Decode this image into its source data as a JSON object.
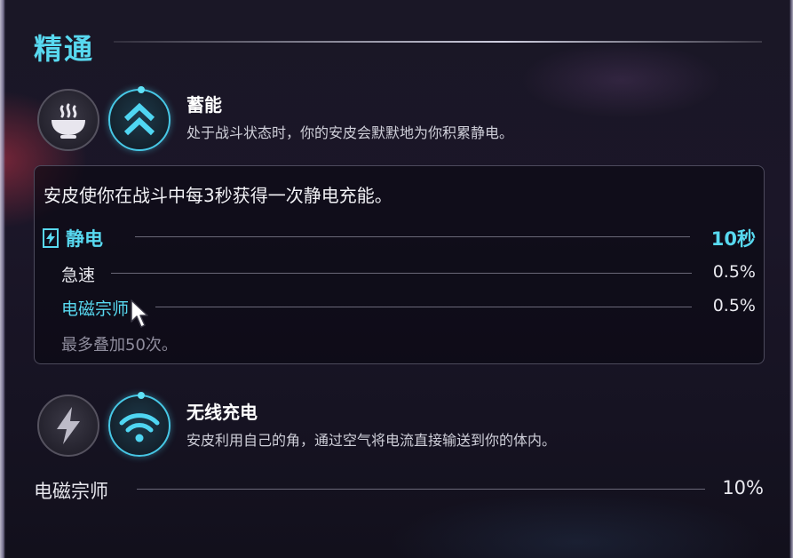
{
  "section": {
    "title": "精通"
  },
  "talent1": {
    "icon_left": "bowl-icon",
    "icon_right": "double-chevron-up-icon",
    "name": "蓄能",
    "description": "处于战斗状态时，你的安皮会默默地为你积累静电。"
  },
  "detail": {
    "main_text": "安皮使你在战斗中每3秒获得一次静电充能。",
    "rows": [
      {
        "label": "静电",
        "value": "10秒",
        "icon": "lightning-box-icon"
      },
      {
        "label": "急速",
        "value": "0.5%"
      },
      {
        "label": "电磁宗师",
        "value": "0.5%"
      }
    ],
    "footer": "最多叠加50次。"
  },
  "talent2": {
    "icon_left": "lightning-icon",
    "icon_right": "wifi-icon",
    "name": "无线充电",
    "description": "安皮利用自己的角，通过空气将电流直接输送到你的体内。"
  },
  "bottom_stat": {
    "label": "电磁宗师",
    "value": "10%"
  },
  "colors": {
    "accent": "#58d9f0",
    "text": "#e9e9ef",
    "muted": "#8e8c9c"
  }
}
